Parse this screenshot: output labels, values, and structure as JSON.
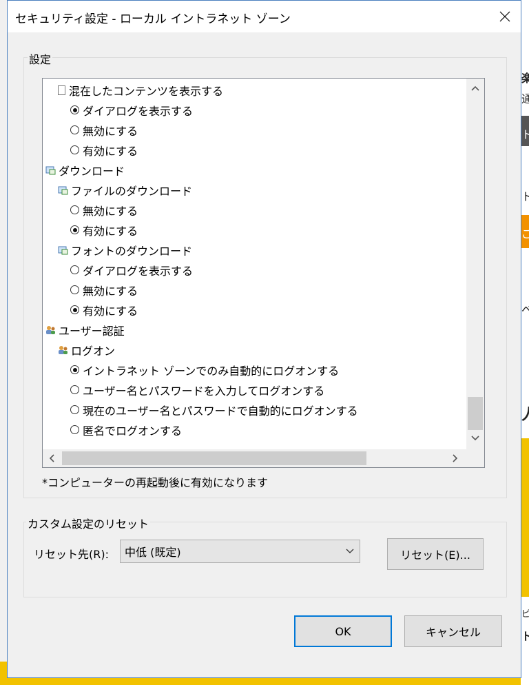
{
  "title": "セキュリティ設定 - ローカル イントラネット ゾーン",
  "settings_group": {
    "label": "設定",
    "rows": [
      {
        "kind": "doc",
        "level": 1,
        "label": "混在したコンテンツを表示する"
      },
      {
        "kind": "radio",
        "level": 2,
        "checked": true,
        "label": "ダイアログを表示する"
      },
      {
        "kind": "radio",
        "level": 2,
        "checked": false,
        "label": "無効にする"
      },
      {
        "kind": "radio",
        "level": 2,
        "checked": false,
        "label": "有効にする"
      },
      {
        "kind": "category",
        "level": 0,
        "label": "ダウンロード"
      },
      {
        "kind": "category",
        "level": 1,
        "label": "ファイルのダウンロード"
      },
      {
        "kind": "radio",
        "level": 2,
        "checked": false,
        "label": "無効にする"
      },
      {
        "kind": "radio",
        "level": 2,
        "checked": true,
        "label": "有効にする"
      },
      {
        "kind": "category",
        "level": 1,
        "label": "フォントのダウンロード"
      },
      {
        "kind": "radio",
        "level": 2,
        "checked": false,
        "label": "ダイアログを表示する"
      },
      {
        "kind": "radio",
        "level": 2,
        "checked": false,
        "label": "無効にする"
      },
      {
        "kind": "radio",
        "level": 2,
        "checked": true,
        "label": "有効にする"
      },
      {
        "kind": "user",
        "level": 0,
        "label": "ユーザー認証"
      },
      {
        "kind": "user",
        "level": 1,
        "label": "ログオン"
      },
      {
        "kind": "radio",
        "level": 2,
        "checked": true,
        "label": "イントラネット ゾーンでのみ自動的にログオンする"
      },
      {
        "kind": "radio",
        "level": 2,
        "checked": false,
        "label": "ユーザー名とパスワードを入力してログオンする"
      },
      {
        "kind": "radio",
        "level": 2,
        "checked": false,
        "label": "現在のユーザー名とパスワードで自動的にログオンする"
      },
      {
        "kind": "radio",
        "level": 2,
        "checked": false,
        "label": "匿名でログオンする"
      }
    ],
    "note": "*コンピューターの再起動後に有効になります"
  },
  "reset_group": {
    "label": "カスタム設定のリセット",
    "reset_to_label": "リセット先(R):",
    "selected_level": "中低 (既定)",
    "reset_button": "リセット(E)..."
  },
  "footer": {
    "ok": "OK",
    "cancel": "キャンセル"
  },
  "background_chars": [
    "楽",
    "通",
    "ト",
    "ト",
    "ご",
    "ベ",
    "人",
    "ピ",
    "ト"
  ],
  "colors": {
    "accent": "#0078d7",
    "dialog_border": "#4a7fbf",
    "background_yellow": "#f2c200"
  }
}
